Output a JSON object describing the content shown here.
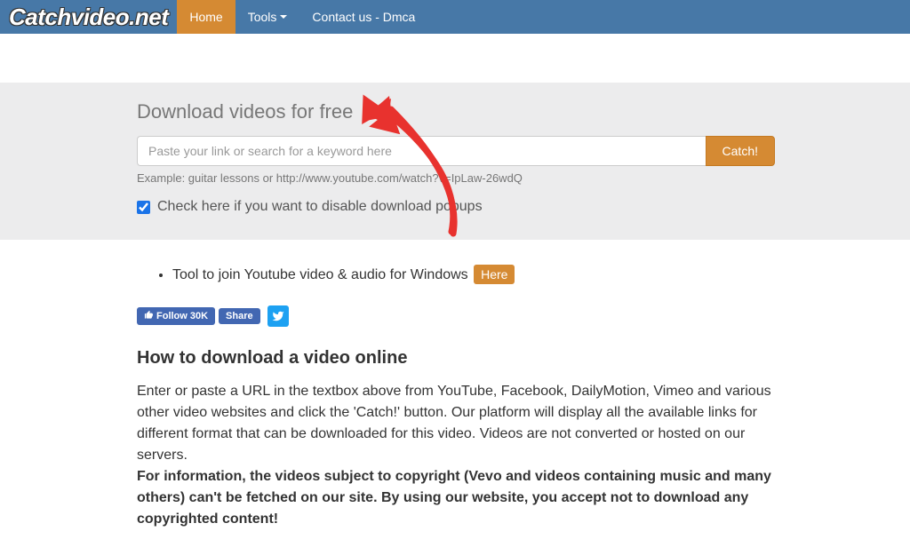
{
  "nav": {
    "brand": "Catchvideo.net",
    "items": [
      {
        "label": "Home",
        "active": true
      },
      {
        "label": "Tools",
        "dropdown": true
      },
      {
        "label": "Contact us - Dmca"
      }
    ]
  },
  "hero": {
    "title": "Download videos for free",
    "placeholder": "Paste your link or search for a keyword here",
    "button": "Catch!",
    "example": "Example: guitar lessons or http://www.youtube.com/watch?v=IpLaw-26wdQ",
    "checkbox_label": "Check here if you want to disable download popups"
  },
  "tool": {
    "text": "Tool to join Youtube video & audio for Windows",
    "button": "Here"
  },
  "social": {
    "follow": "Follow",
    "follow_count": "30K",
    "share": "Share"
  },
  "howto": {
    "heading": "How to download a video online",
    "p1": "Enter or paste a URL in the textbox above from YouTube, Facebook, DailyMotion, Vimeo and various other video websites and click the 'Catch!' button. Our platform will display all the available links for different format that can be downloaded for this video. Videos are not converted or hosted on our servers.",
    "p2": "For information, the videos subject to copyright (Vevo and videos containing music and many others) can't be fetched on our site. By using our website, you accept not to download any copyrighted content!"
  }
}
